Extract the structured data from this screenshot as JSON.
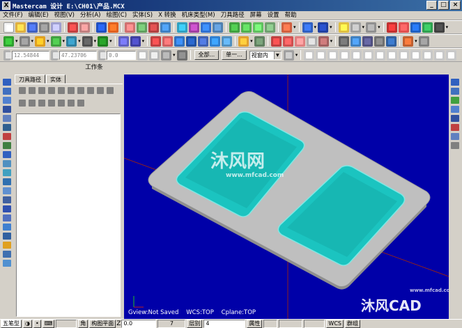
{
  "window": {
    "title": "Mastercam 设计  E:\\CH01\\产品.MCX",
    "logo_text": "X"
  },
  "menu": [
    "文件(F)",
    "编辑(E)",
    "视图(V)",
    "分析(A)",
    "绘图(C)",
    "实体(S)",
    "X 转换",
    "机床类型(M)",
    "刀具路径",
    "屏幕",
    "设置",
    "帮助"
  ],
  "ribbon": {
    "coord_x": "12.54844",
    "coord_y": "47.23706",
    "coord_z": "0.0",
    "all_button": "全部...",
    "single_button": "单一...",
    "mode_select": "视窗内",
    "workpane_title": "工作条"
  },
  "ops_manager": {
    "tabs": [
      "刀具路径",
      "实体"
    ]
  },
  "viewport": {
    "gview": "Gview:Not Saved",
    "wcs": "WCS:TOP",
    "cplane": "Cplane:TOP",
    "watermark_main": "沐风网",
    "watermark_url": "www.mfcad.com",
    "watermark_corner": "沐风CAD",
    "watermark_corner_url": "www.mfcad.com",
    "bg_color": "#0000a8",
    "part_color": "#bfbfbf",
    "pocket_color": "#1bc4c0"
  },
  "statusbar": {
    "left_tab": "五笔型",
    "mode": "角",
    "construct_plane": "构图平面",
    "z_label": "Z",
    "z_value": "0.0",
    "color_value": "7",
    "level_label": "层别",
    "level_value": "4",
    "attribute_label": "属性",
    "wcs_label": "WCS",
    "group_label": "群组"
  }
}
